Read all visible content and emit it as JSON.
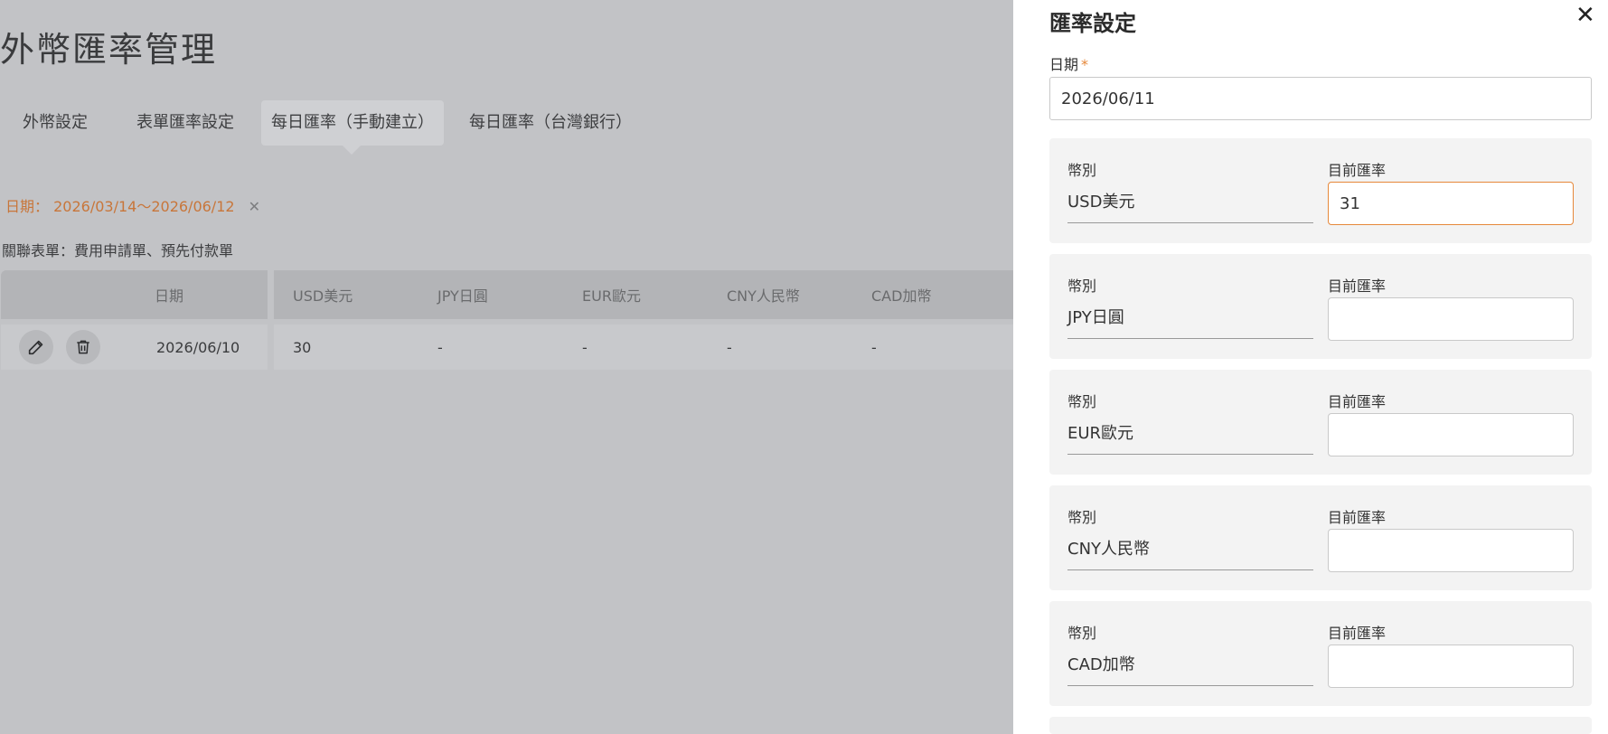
{
  "page": {
    "title": "外幣匯率管理",
    "tabs": [
      {
        "label": "外幣設定"
      },
      {
        "label": "表單匯率設定"
      },
      {
        "label": "每日匯率（手動建立）"
      },
      {
        "label": "每日匯率（台灣銀行）"
      }
    ],
    "active_tab": 2,
    "filter": {
      "label": "日期：",
      "value": "2026/03/14～2026/06/12",
      "clear_icon": "close-icon"
    },
    "related_forms": "關聯表單：費用申請單、預先付款單",
    "table": {
      "headers": [
        "日期",
        "USD美元",
        "JPY日圓",
        "EUR歐元",
        "CNY人民幣",
        "CAD加幣"
      ],
      "rows": [
        {
          "date": "2026/06/10",
          "cells": [
            "30",
            "-",
            "-",
            "-",
            "-"
          ],
          "actions": [
            "edit-icon",
            "trash-icon"
          ]
        }
      ]
    }
  },
  "drawer": {
    "title": "匯率設定",
    "close_icon": "close-icon",
    "date_label": "日期",
    "required_mark": "*",
    "date_value": "2026/06/11",
    "currency_label": "幣別",
    "rate_label": "目前匯率",
    "currencies": [
      {
        "currency": "USD美元",
        "rate": "31",
        "focused": true
      },
      {
        "currency": "JPY日圓",
        "rate": ""
      },
      {
        "currency": "EUR歐元",
        "rate": ""
      },
      {
        "currency": "CNY人民幣",
        "rate": ""
      },
      {
        "currency": "CAD加幣",
        "rate": ""
      }
    ]
  },
  "colors": {
    "overlay": "#c2c3c6",
    "accent": "#e6883a",
    "filter_text": "#c8763a"
  }
}
